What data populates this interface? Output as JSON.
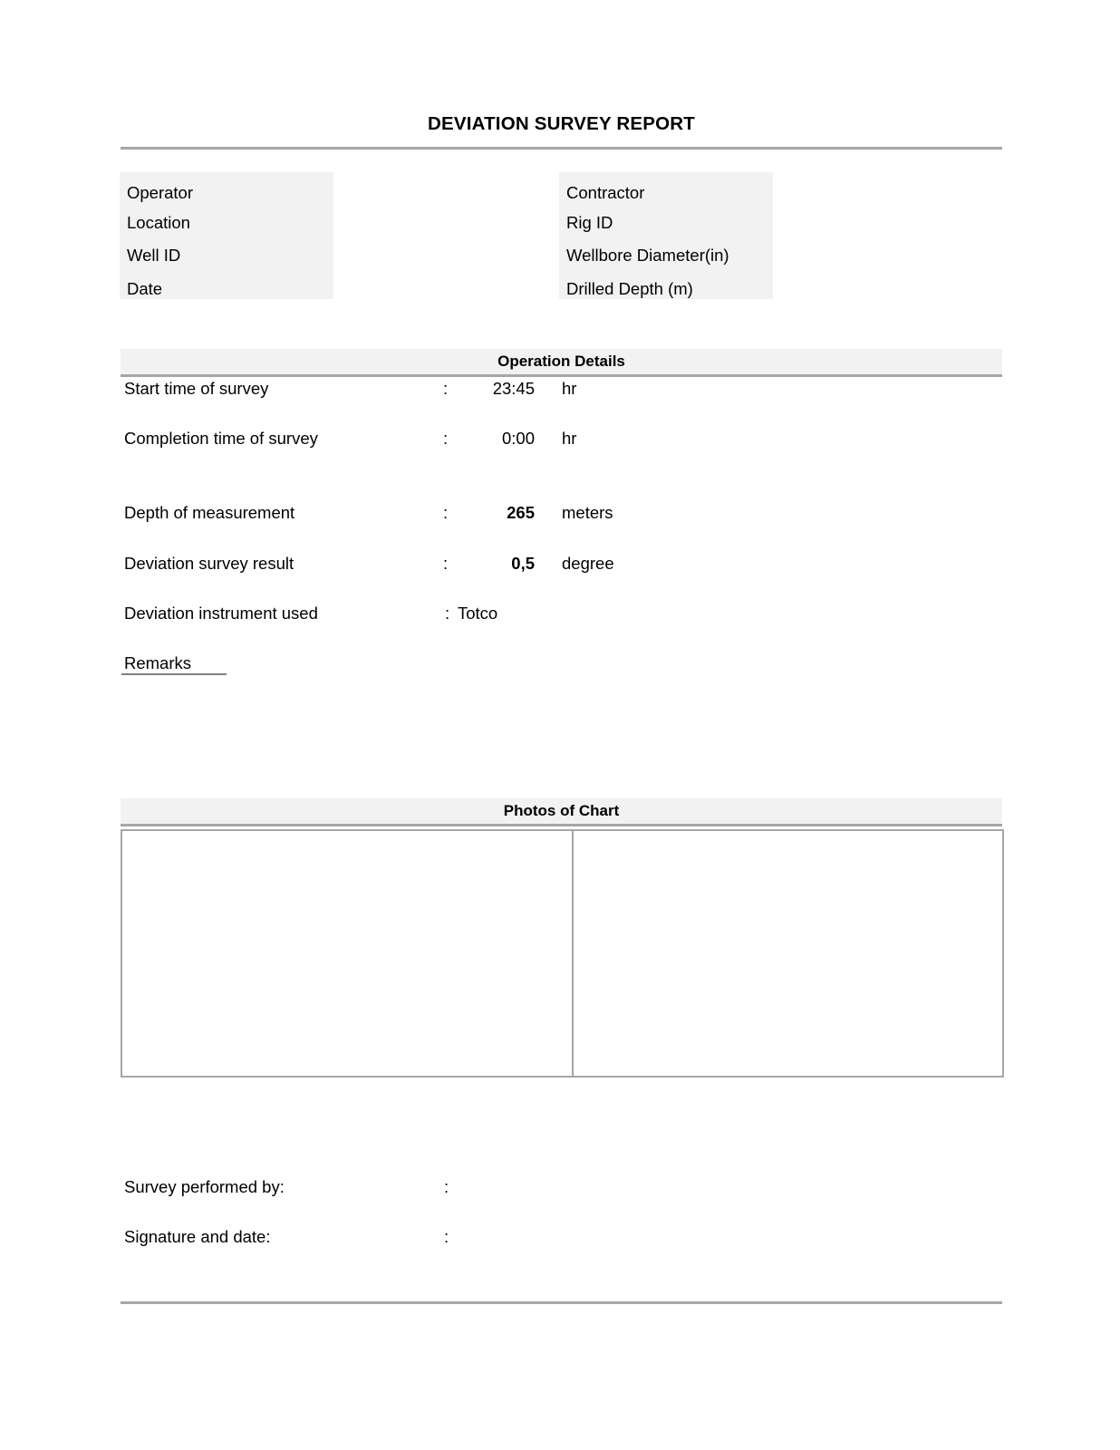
{
  "document": {
    "title": "DEVIATION SURVEY REPORT"
  },
  "header_info": {
    "left_column": [
      {
        "label": "Operator"
      },
      {
        "label": "Location"
      },
      {
        "label": "Well ID"
      },
      {
        "label": "Date"
      }
    ],
    "right_column": [
      {
        "label": "Contractor"
      },
      {
        "label": "Rig ID"
      },
      {
        "label": "Wellbore Diameter(in)"
      },
      {
        "label": "Drilled Depth (m)"
      }
    ]
  },
  "operation_details": {
    "section_title": "Operation Details",
    "rows": [
      {
        "label": "Start time of survey",
        "colon": ":",
        "value": "23:45",
        "unit": "hr",
        "bold": false
      },
      {
        "label": "Completion time of survey",
        "colon": ":",
        "value": "0:00",
        "unit": "hr",
        "bold": false
      },
      {
        "label": "Depth of measurement",
        "colon": ":",
        "value": "265",
        "unit": "meters",
        "bold": true
      },
      {
        "label": "Deviation survey result",
        "colon": ":",
        "value": "0,5",
        "unit": "degree",
        "bold": true
      },
      {
        "label": "Deviation instrument used",
        "colon": ":",
        "value": "Totco",
        "unit": "",
        "bold": false,
        "inline": true
      }
    ],
    "remarks_label": "Remarks"
  },
  "photos": {
    "section_title": "Photos of Chart",
    "cells": [
      {
        "content": ""
      },
      {
        "content": ""
      }
    ]
  },
  "signature": {
    "rows": [
      {
        "label": "Survey performed by:",
        "colon": ":",
        "value": ""
      },
      {
        "label": "Signature and date:",
        "colon": ":",
        "value": ""
      }
    ]
  },
  "style": {
    "rule_color": "#a6a6a6",
    "band_fill": "#f2f2f2",
    "info_box_fill": "#f2f2f2",
    "text_color": "#000000"
  }
}
